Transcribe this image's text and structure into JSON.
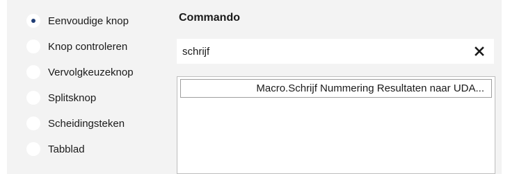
{
  "control_types": [
    {
      "label": "Eenvoudige knop",
      "selected": true
    },
    {
      "label": "Knop controleren",
      "selected": false
    },
    {
      "label": "Vervolgkeuzeknop",
      "selected": false
    },
    {
      "label": "Splitsknop",
      "selected": false
    },
    {
      "label": "Scheidingsteken",
      "selected": false
    },
    {
      "label": "Tabblad",
      "selected": false
    }
  ],
  "command": {
    "title": "Commando",
    "search_value": "schrijf",
    "results": [
      {
        "label": "Macro.Schrijf Nummering Resultaten naar UDA..."
      }
    ]
  },
  "icons": {
    "clear": "close-x-icon"
  },
  "colors": {
    "background": "#f3f3f3",
    "radio_dot": "#1f3d75",
    "panel": "#ffffff"
  }
}
